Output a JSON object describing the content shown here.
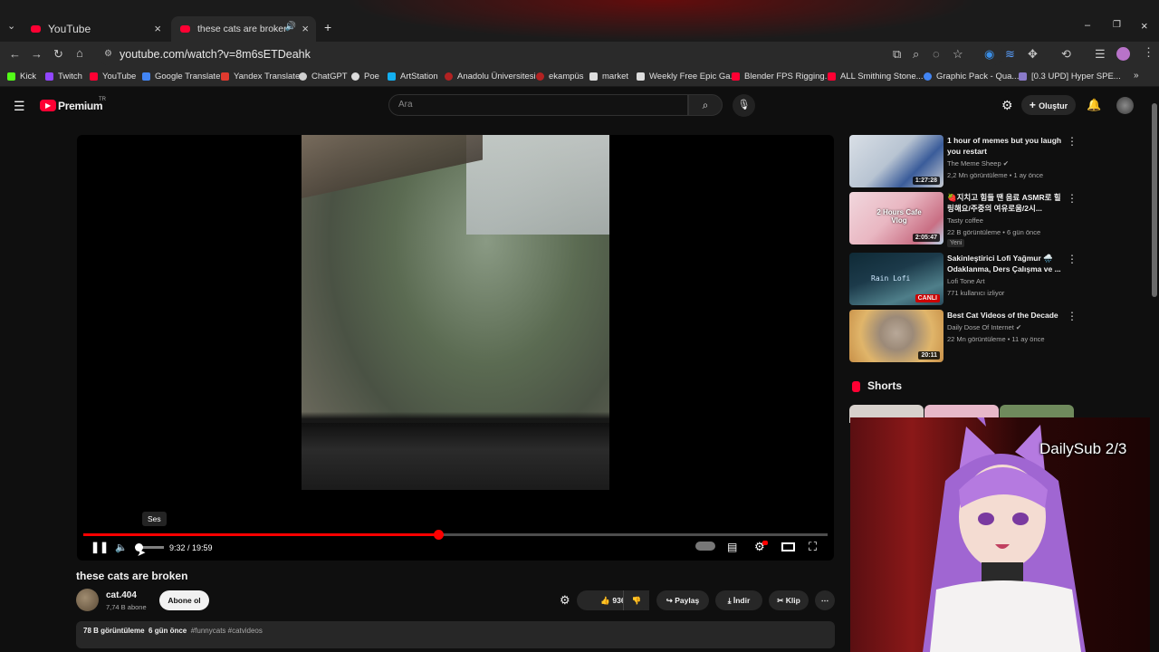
{
  "browser": {
    "tabs": [
      {
        "label": "YouTube",
        "active": false
      },
      {
        "label": "these cats are broken - You",
        "active": true
      }
    ],
    "new_tab": "+",
    "url": "youtube.com/watch?v=8m6sETDeahk",
    "bookmarks": [
      "Kick",
      "Twitch",
      "YouTube",
      "Google Translate",
      "Yandex Translate",
      "ChatGPT",
      "Poe",
      "ArtStation",
      "Anadolu Üniversitesi",
      "ekampüs",
      "market",
      "Weekly Free Epic Ga...",
      "Blender FPS Rigging...",
      "ALL Smithing Stone...",
      "Graphic Pack - Qua...",
      "[0.3 UPD] Hyper SPE..."
    ]
  },
  "header": {
    "logo": "Premium",
    "logo_region": "TR",
    "search_placeholder": "Ara",
    "create_label": "Oluştur"
  },
  "player": {
    "tooltip": "Ses",
    "current_time": "9:32",
    "duration": "19:59",
    "time_display": "9:32 / 19:59",
    "progress_fraction": 0.477
  },
  "video": {
    "title": "these cats are broken",
    "channel": "cat.404",
    "subscribers": "7,74 B abone",
    "subscribe_label": "Abone ol",
    "likes": "936",
    "share_label": "Paylaş",
    "download_label": "İndir",
    "clip_label": "Klip",
    "views": "78 B görüntüleme",
    "age": "6 gün önce",
    "tags": "#funnycats #catvideos"
  },
  "recommendations": [
    {
      "title": "1 hour of memes but you laugh you restart",
      "channel": "The Meme Sheep",
      "meta": "2,2 Mn görüntüleme • 1 ay önce",
      "duration": "1:27:28",
      "colors": [
        "#d9dfe6",
        "#3a5c9a"
      ]
    },
    {
      "title": "🍓지치고 힘들 땐 음료 ASMR로 힐링해요/주중의 여유로움/2시...",
      "channel": "Tasty coffee",
      "meta": "22 B görüntüleme • 6 gün önce",
      "badge": "Yeni",
      "duration": "2:05:47",
      "thumb_text": "2 Hours Cafe Vlog",
      "colors": [
        "#e9b7c2",
        "#c96f84"
      ]
    },
    {
      "title": "Sakinleştirici Lofi Yağmur 🌧️ Odaklanma, Ders Çalışma ve ...",
      "channel": "Lofi Tone Art",
      "meta": "771 kullanıcı izliyor",
      "live": "CANLI",
      "thumb_text": "Rain Lofi",
      "colors": [
        "#1c3a4a",
        "#4f7f8a"
      ]
    },
    {
      "title": "Best Cat Videos of the Decade",
      "channel": "Daily Dose Of Internet",
      "meta": "22 Mn görüntüleme • 11 ay önce",
      "duration": "20:11",
      "colors": [
        "#e0b56a",
        "#9c8a78"
      ]
    }
  ],
  "shorts": {
    "title": "Shorts"
  },
  "overlay": {
    "text": "DailySub 2/3"
  }
}
